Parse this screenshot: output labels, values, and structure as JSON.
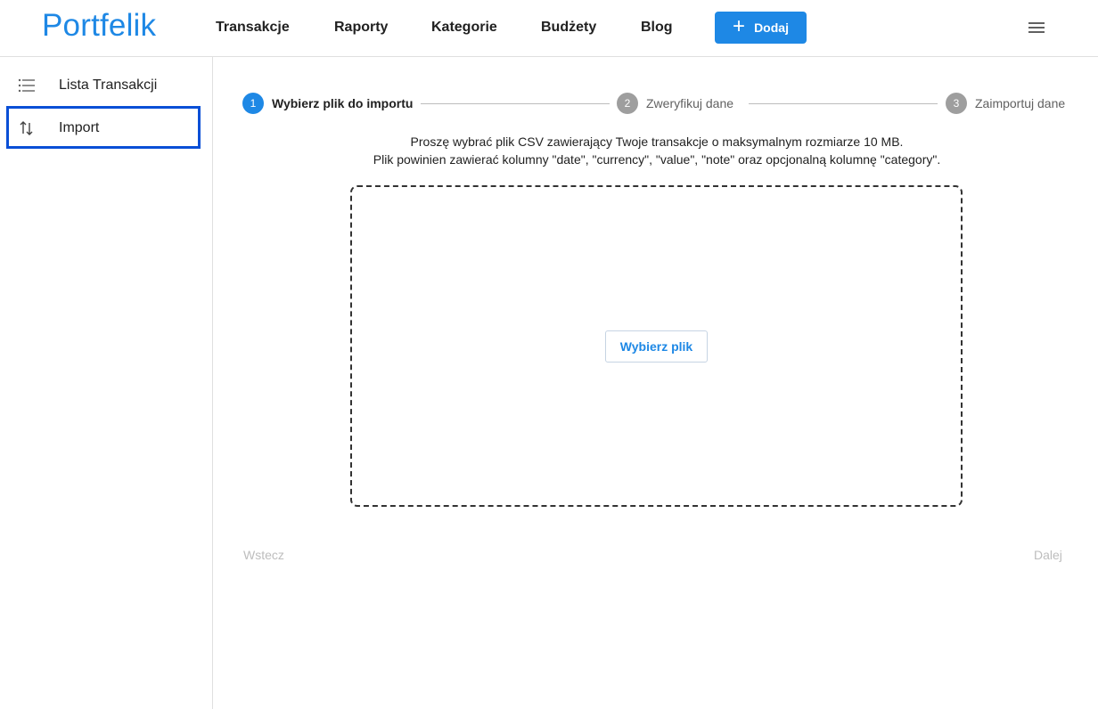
{
  "header": {
    "logo": "Portfelik",
    "nav": [
      "Transakcje",
      "Raporty",
      "Kategorie",
      "Budżety",
      "Blog"
    ],
    "add_label": "Dodaj",
    "menu_icon": "hamburger-menu-icon"
  },
  "sidebar": {
    "items": [
      {
        "label": "Lista Transakcji",
        "icon": "list-icon"
      },
      {
        "label": "Import",
        "icon": "swap-vertical-icon",
        "selected": true
      }
    ]
  },
  "stepper": {
    "steps": [
      {
        "number": "1",
        "label": "Wybierz plik do importu",
        "active": true
      },
      {
        "number": "2",
        "label": "Zweryfikuj dane",
        "active": false
      },
      {
        "number": "3",
        "label": "Zaimportuj dane",
        "active": false
      }
    ]
  },
  "instructions": {
    "line1": "Proszę wybrać plik CSV zawierający Twoje transakcje o maksymalnym rozmiarze 10 MB.",
    "line2": "Plik powinien zawierać kolumny \"date\", \"currency\", \"value\", \"note\" oraz opcjonalną kolumnę \"category\"."
  },
  "dropzone": {
    "button_label": "Wybierz plik"
  },
  "footer_nav": {
    "back_label": "Wstecz",
    "next_label": "Dalej"
  },
  "colors": {
    "accent": "#1e88e5",
    "focus_outline": "#0a4fd6",
    "inactive_step": "#9e9e9e",
    "disabled_text": "#bdbdbd"
  }
}
